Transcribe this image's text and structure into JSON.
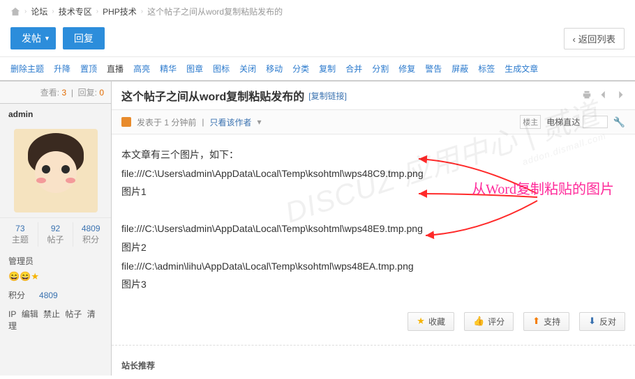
{
  "breadcrumb": {
    "b1": "论坛",
    "b2": "技术专区",
    "b3": "PHP技术",
    "b4": "这个帖子之间从word复制粘贴发布的"
  },
  "toolbar": {
    "new_post": "发帖",
    "reply": "回复",
    "back": "返回列表"
  },
  "modbar": [
    "删除主题",
    "升降",
    "置顶",
    "直播",
    "高亮",
    "精华",
    "图章",
    "图标",
    "关闭",
    "移动",
    "分类",
    "复制",
    "合并",
    "分割",
    "修复",
    "警告",
    "屏蔽",
    "标签",
    "生成文章"
  ],
  "side": {
    "views_label": "查看:",
    "views": "3",
    "replies_label": "回复:",
    "replies": "0",
    "author": "admin",
    "stat_topics_n": "73",
    "stat_topics_l": "主题",
    "stat_posts_n": "92",
    "stat_posts_l": "帖子",
    "stat_points_n": "4809",
    "stat_points_l": "积分",
    "role": "管理员",
    "points_label": "积分",
    "points_value": "4809",
    "ip": "IP",
    "op_edit": "编辑",
    "op_ban": "禁止",
    "op_post": "帖子",
    "op_clean": "清理"
  },
  "thread": {
    "title": "这个帖子之间从word复制粘贴发布的",
    "copylink": "[复制链接]",
    "posted": "发表于 1 分钟前",
    "only_author": "只看该作者",
    "floor": "楼主",
    "elevator": "电梯直达",
    "body_intro": "本文章有三个图片，如下：",
    "line1": "file:///C:\\Users\\admin\\AppData\\Local\\Temp\\ksohtml\\wps48C9.tmp.png",
    "img1": "图片1",
    "line2": "file:///C:\\Users\\admin\\AppData\\Local\\Temp\\ksohtml\\wps48E9.tmp.png",
    "img2": "图片2",
    "line3": "file:///C:\\admin\\lihu\\AppData\\Local\\Temp\\ksohtml\\wps48EA.tmp.png",
    "img3": "图片3",
    "annotation": "从Word复制粘贴的图片",
    "act_fav": "收藏",
    "act_rate": "评分",
    "act_support": "支持",
    "act_oppose": "反对",
    "rec_title": "站长推荐"
  }
}
